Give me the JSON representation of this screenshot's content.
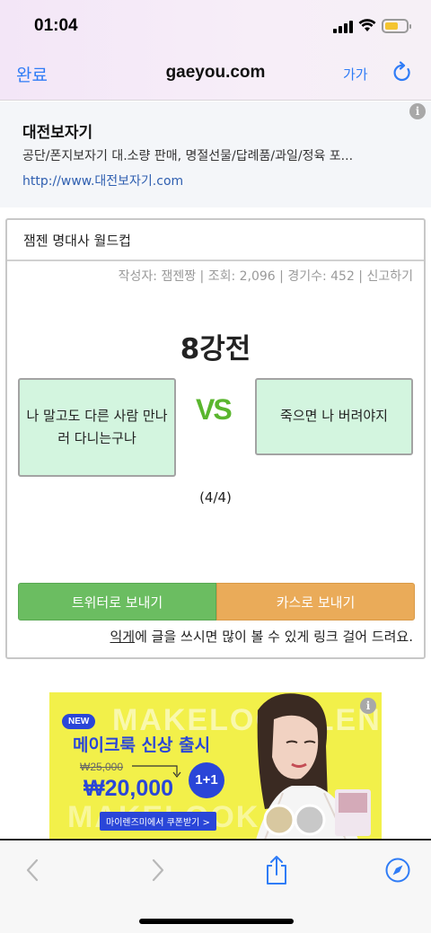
{
  "status_bar": {
    "time": "01:04"
  },
  "nav": {
    "done_label": "완료",
    "url": "gaeyou.com",
    "text_size_label": "가가"
  },
  "top_ad": {
    "title": "대전보자기",
    "description": "공단/폰지보자기 대.소량 판매, 명절선물/답례품/과일/정육 포...",
    "link": "http://www.대전보자기.com"
  },
  "game": {
    "header": "잼젠 명대사 월드컵",
    "meta": "작성자: 잼젠짱 | 조회: 2,096 | 경기수: 452 | 신고하기",
    "round_title": "8강전",
    "left_choice": "나 말고도 다른 사람 만나러 다니는구나",
    "vs_label": "VS",
    "right_choice": "죽으면 나 버려야지",
    "progress": "(4/4)",
    "share_twitter": "트위터로 보내기",
    "share_kakao": "카스로 보내기",
    "note_link": "익게",
    "note_text": "에 글을 쓰시면 많이 볼 수 있게 링크 걸어 드려요."
  },
  "banner_ad": {
    "badge": "NEW",
    "headline": "메이크룩 신상 출시",
    "old_price": "₩25,000",
    "price": "₩20,000",
    "promo": "1+1",
    "coupon": "마이렌즈미에서 쿠폰받기 >",
    "bg_text_top": "MAKELOOK LENSES",
    "bg_text_bottom": "MAKELOOK"
  },
  "colors": {
    "accent": "#2f7cf6",
    "choice_bg": "#d3f5df",
    "vs": "#5ab62e",
    "twitter": "#6bbd61",
    "kakao": "#eaab59",
    "banner_bg": "#f2f04a",
    "banner_blue": "#2a46d8"
  },
  "icons": [
    "signal-icon",
    "wifi-icon",
    "battery-icon",
    "reload-icon",
    "info-icon",
    "back-icon",
    "forward-icon",
    "share-icon",
    "compass-icon"
  ]
}
